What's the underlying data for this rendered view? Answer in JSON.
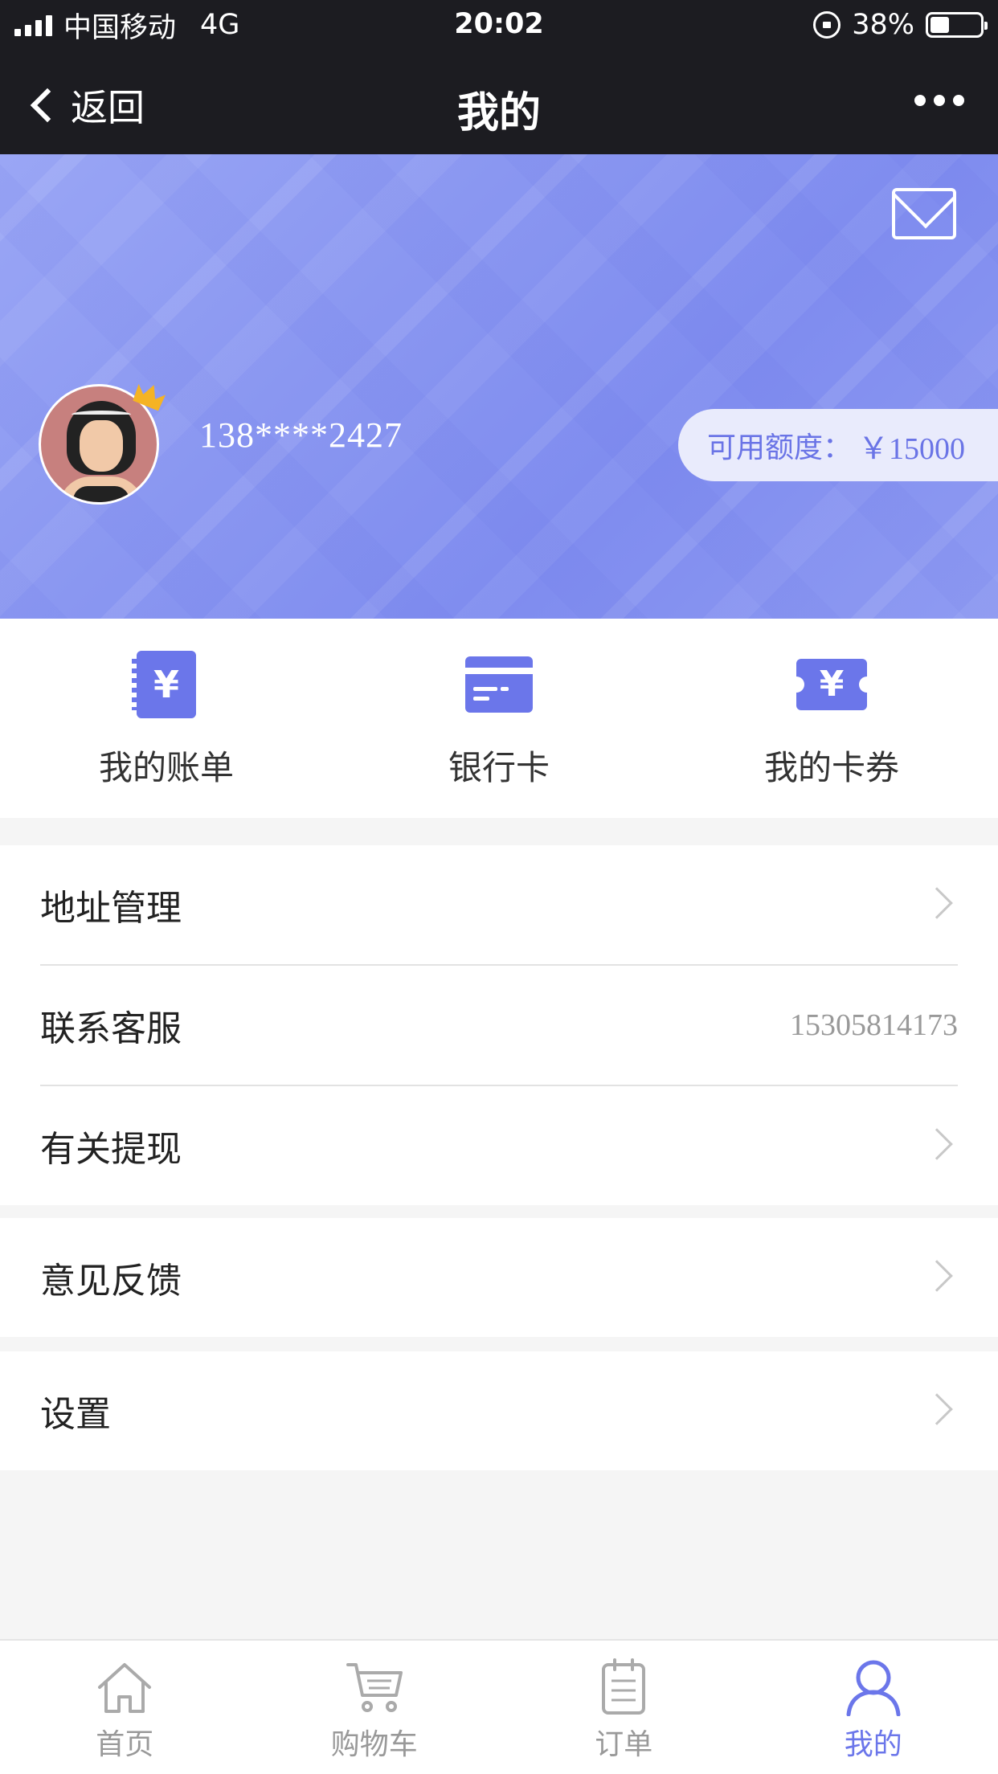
{
  "status_bar": {
    "carrier": "中国移动",
    "network": "4G",
    "time": "20:02",
    "battery": "38%",
    "battery_level": 0.38
  },
  "nav": {
    "back_label": "返回",
    "title": "我的"
  },
  "profile": {
    "phone": "138****2427",
    "credit_label": "可用额度：",
    "credit_value": "￥15000"
  },
  "quick_actions": [
    {
      "label": "我的账单",
      "icon": "bill-icon"
    },
    {
      "label": "银行卡",
      "icon": "bank-card-icon"
    },
    {
      "label": "我的卡券",
      "icon": "coupon-icon"
    }
  ],
  "menu": {
    "address": "地址管理",
    "service": "联系客服",
    "service_phone": "15305814173",
    "withdraw": "有关提现",
    "feedback": "意见反馈",
    "settings": "设置"
  },
  "tabs": [
    {
      "label": "首页",
      "icon": "home-icon"
    },
    {
      "label": "购物车",
      "icon": "cart-icon"
    },
    {
      "label": "订单",
      "icon": "order-icon"
    },
    {
      "label": "我的",
      "icon": "user-icon",
      "active": true
    }
  ],
  "colors": {
    "accent": "#6b76ea",
    "header_bg": "#1c1c21",
    "banner": "#8a97f1",
    "inactive_tab": "#999999"
  }
}
